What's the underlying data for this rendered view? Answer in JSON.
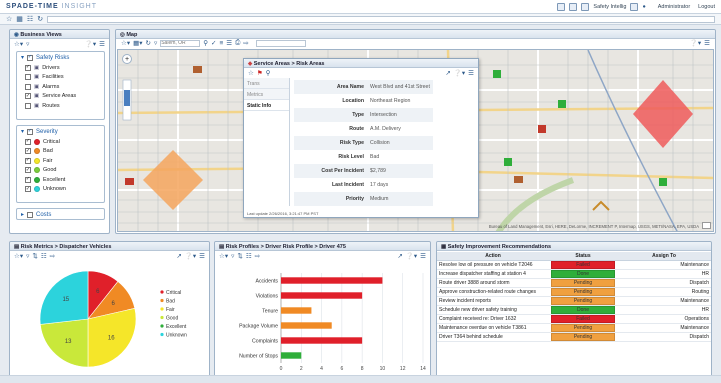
{
  "app": {
    "brand_main": "SPADE-TIME",
    "brand_sub": "INSIGHT",
    "dashboard_name": "Safety Intellig",
    "user": "Administrator",
    "logout": "Logout"
  },
  "left": {
    "title": "Business Views",
    "safety_risks": {
      "title": "Safety Risks",
      "items": [
        {
          "label": "Drivers",
          "checked": true,
          "icon": "person-icon"
        },
        {
          "label": "Facilities",
          "checked": false,
          "icon": "building-icon"
        },
        {
          "label": "Alarms",
          "checked": false,
          "icon": "alarm-icon"
        },
        {
          "label": "Service Areas",
          "checked": true,
          "icon": "area-icon"
        },
        {
          "label": "Routes",
          "checked": false,
          "icon": "route-icon"
        }
      ]
    },
    "severity": {
      "title": "Severity",
      "items": [
        {
          "label": "Critical",
          "color": "#e0202a"
        },
        {
          "label": "Bad",
          "color": "#f08a24"
        },
        {
          "label": "Fair",
          "color": "#f5e629"
        },
        {
          "label": "Good",
          "color": "#7ccd3c"
        },
        {
          "label": "Excellent",
          "color": "#2fae3a"
        },
        {
          "label": "Unknown",
          "color": "#2cd3dc"
        }
      ]
    },
    "costs": "Costs"
  },
  "map": {
    "title": "Map",
    "search_placeholder": "Salem, OR",
    "attribution": "Bureau of Land Management, Esri, HERE, DeLorme, INCREMENT P, Intermap, USGS, METI/NASA, EPA, USDA"
  },
  "popup": {
    "title": "Service Areas > Risk Areas",
    "tabs": [
      "Trans",
      "Metrics",
      "Static Info"
    ],
    "active_tab": "Static Info",
    "fields": [
      {
        "k": "Area Name",
        "v": "West Blvd and 41st Street"
      },
      {
        "k": "Location",
        "v": "Northeast Region"
      },
      {
        "k": "Type",
        "v": "Intersection"
      },
      {
        "k": "Route",
        "v": "A.M. Delivery"
      },
      {
        "k": "Risk Type",
        "v": "Collision"
      },
      {
        "k": "Risk Level",
        "v": "Bad"
      },
      {
        "k": "Cost Per Incident",
        "v": "$2,789"
      },
      {
        "k": "Last Incident",
        "v": "17 days"
      },
      {
        "k": "Priority",
        "v": "Medium"
      }
    ],
    "footer": "Last update 2/26/2016, 3:21:47 PM PST"
  },
  "pie_panel": {
    "title": "Risk Metrics > Dispatcher Vehicles"
  },
  "chart_data": [
    {
      "type": "pie",
      "categories": [
        "Critical",
        "Bad",
        "Fair",
        "Good",
        "Excellent",
        "Unknown"
      ],
      "values": [
        6,
        6,
        16,
        13,
        0,
        15
      ],
      "colors": [
        "#e0202a",
        "#f08a24",
        "#f5e629",
        "#c9e83a",
        "#2fae3a",
        "#2cd3dc"
      ],
      "legend": "right"
    },
    {
      "type": "bar",
      "title": "Risk Profiles > Driver Risk Profile > Driver 475",
      "categories": [
        "Accidents",
        "Violations",
        "Tenure",
        "Package Volume",
        "Complaints",
        "Number of Stops"
      ],
      "values": [
        10,
        8,
        3,
        5,
        8,
        2
      ],
      "colors": [
        "#e0202a",
        "#e0202a",
        "#f08a24",
        "#f08a24",
        "#e0202a",
        "#2fae3a"
      ],
      "xlim": [
        0,
        14
      ],
      "xticks": [
        0,
        2,
        4,
        6,
        8,
        10,
        12,
        14
      ],
      "grid": true
    }
  ],
  "rec_panel": {
    "title": "Safety Improvement Recommendations",
    "columns": [
      "Action",
      "Status",
      "Assign To"
    ],
    "rows": [
      {
        "action": "Resolve low oil pressure on vehicle T2046",
        "status": "Failed",
        "color": "#e0202a",
        "assign": "Maintenance"
      },
      {
        "action": "Increase dispatcher staffing at station 4",
        "status": "Done",
        "color": "#2fae3a",
        "assign": "HR"
      },
      {
        "action": "Route driver 3888 around storm",
        "status": "Pending",
        "color": "#f0a040",
        "assign": "Dispatch"
      },
      {
        "action": "Approve construction-related route changes",
        "status": "Pending",
        "color": "#f0a040",
        "assign": "Routing"
      },
      {
        "action": "Review incident reports",
        "status": "Pending",
        "color": "#f0a040",
        "assign": "Maintenance"
      },
      {
        "action": "Schedule new driver safety training",
        "status": "Done",
        "color": "#2fae3a",
        "assign": "HR"
      },
      {
        "action": "Complaint received re: Driver 1632",
        "status": "Failed",
        "color": "#e0202a",
        "assign": "Operations"
      },
      {
        "action": "Maintenance overdue on vehicle T3861",
        "status": "Pending",
        "color": "#f0a040",
        "assign": "Maintenance"
      },
      {
        "action": "Driver T364 behind schedule",
        "status": "Pending",
        "color": "#f0a040",
        "assign": "Dispatch"
      }
    ]
  }
}
